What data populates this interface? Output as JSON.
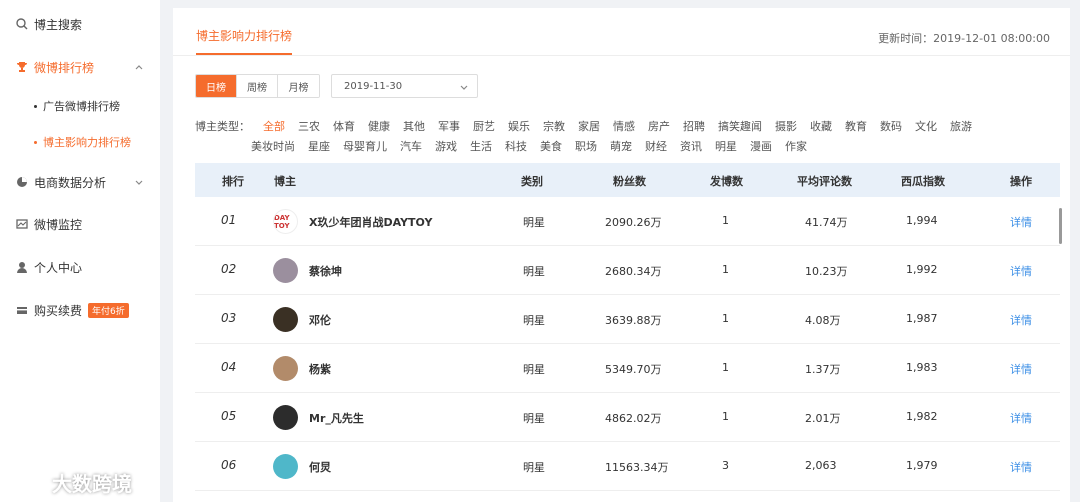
{
  "sidebar": {
    "items": [
      {
        "label": "博主搜索",
        "icon": "search-icon"
      },
      {
        "label": "微博排行榜",
        "icon": "trophy-icon"
      },
      {
        "label": "电商数据分析",
        "icon": "pie-chart-icon"
      },
      {
        "label": "微博监控",
        "icon": "monitor-icon"
      },
      {
        "label": "个人中心",
        "icon": "user-icon"
      },
      {
        "label": "购买续费",
        "icon": "card-icon",
        "badge": "年付6折"
      }
    ],
    "sub_items": [
      "广告微博排行榜",
      "博主影响力排行榜"
    ]
  },
  "watermark": {
    "text": "大数跨境"
  },
  "header": {
    "tab_title": "博主影响力排行榜",
    "updated": "更新时间：2019-12-01 08:00:00"
  },
  "filters": {
    "periods": [
      "日榜",
      "周榜",
      "月榜"
    ],
    "active_period": "日榜",
    "date": "2019-11-30",
    "category_label": "博主类型：",
    "categories_row1": [
      "全部",
      "三农",
      "体育",
      "健康",
      "其他",
      "军事",
      "厨艺",
      "娱乐",
      "宗教",
      "家居",
      "情感",
      "房产",
      "招聘",
      "搞笑趣闻",
      "摄影",
      "收藏",
      "教育",
      "数码",
      "文化",
      "旅游"
    ],
    "categories_row2": [
      "美妆时尚",
      "星座",
      "母婴育儿",
      "汽车",
      "游戏",
      "生活",
      "科技",
      "美食",
      "职场",
      "萌宠",
      "财经",
      "资讯",
      "明星",
      "漫画",
      "作家"
    ],
    "active_category": "全部"
  },
  "table": {
    "headers": [
      "排行",
      "博主",
      "类别",
      "粉丝数",
      "发博数",
      "平均评论数",
      "西瓜指数",
      "操作"
    ],
    "rows": [
      {
        "rank": "01",
        "name": "X玖少年团肖战DAYTOY",
        "category": "明星",
        "fans": "2090.26万",
        "posts": "1",
        "avg_comments": "41.74万",
        "index": "1,994",
        "action": "详情",
        "avatar_text": "DAY TOY",
        "avatar_color": "#ffffff"
      },
      {
        "rank": "02",
        "name": "蔡徐坤",
        "category": "明星",
        "fans": "2680.34万",
        "posts": "1",
        "avg_comments": "10.23万",
        "index": "1,992",
        "action": "详情",
        "avatar_text": "",
        "avatar_color": "#9b8f9e"
      },
      {
        "rank": "03",
        "name": "邓伦",
        "category": "明星",
        "fans": "3639.88万",
        "posts": "1",
        "avg_comments": "4.08万",
        "index": "1,987",
        "action": "详情",
        "avatar_text": "",
        "avatar_color": "#3a3024"
      },
      {
        "rank": "04",
        "name": "杨紫",
        "category": "明星",
        "fans": "5349.70万",
        "posts": "1",
        "avg_comments": "1.37万",
        "index": "1,983",
        "action": "详情",
        "avatar_text": "",
        "avatar_color": "#b28b6a"
      },
      {
        "rank": "05",
        "name": "Mr_凡先生",
        "category": "明星",
        "fans": "4862.02万",
        "posts": "1",
        "avg_comments": "2.01万",
        "index": "1,982",
        "action": "详情",
        "avatar_text": "",
        "avatar_color": "#2c2c2c"
      },
      {
        "rank": "06",
        "name": "何炅",
        "category": "明星",
        "fans": "11563.34万",
        "posts": "3",
        "avg_comments": "2,063",
        "index": "1,979",
        "action": "详情",
        "avatar_text": "",
        "avatar_color": "#4fb7c9"
      }
    ]
  },
  "colors": {
    "accent": "#f56c2d",
    "link": "#3a8ee6",
    "header_bg": "#e8f0f9"
  }
}
